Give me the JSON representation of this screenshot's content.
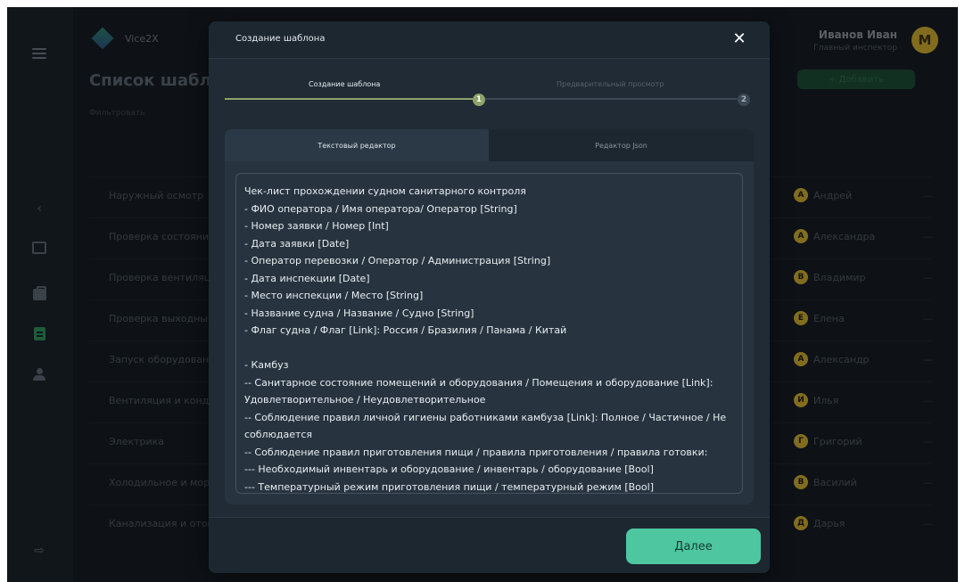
{
  "app": {
    "brand": "Vice2X"
  },
  "user": {
    "name": "Иванов Иван",
    "role": "Главный инспектор",
    "avatar_letter": "M"
  },
  "page": {
    "title": "Список шаблонов",
    "filter_label": "Фильтровать",
    "add_button": "+ Добавить",
    "rows": [
      {
        "name": "Наружный осмотр",
        "user": "Андрей",
        "av": "А",
        "color": "#c8a830"
      },
      {
        "name": "Проверка состояния",
        "user": "Александра",
        "av": "А",
        "color": "#c8a830"
      },
      {
        "name": "Проверка вентиляции",
        "user": "Владимир",
        "av": "В",
        "color": "#c8a830"
      },
      {
        "name": "Проверка выходных",
        "user": "Елена",
        "av": "Е",
        "color": "#c8a830"
      },
      {
        "name": "Запуск оборудования",
        "user": "Александр",
        "av": "А",
        "color": "#c8a830"
      },
      {
        "name": "Вентиляция и конд",
        "user": "Илья",
        "av": "И",
        "color": "#c8a830"
      },
      {
        "name": "Электрика",
        "user": "Григорий",
        "av": "Г",
        "color": "#c8a830"
      },
      {
        "name": "Холодильное и мор",
        "user": "Василий",
        "av": "В",
        "color": "#c8a830"
      },
      {
        "name": "Канализация и отопление",
        "user": "Дарья",
        "av": "Д",
        "color": "#c8a830"
      }
    ]
  },
  "modal": {
    "title": "Создание шаблона",
    "close_icon": "close-icon",
    "steps": [
      {
        "label": "Создание шаблона",
        "number": "1"
      },
      {
        "label": "Предварительный просмотр",
        "number": "2"
      }
    ],
    "tabs": [
      {
        "label": "Текстовый редактор"
      },
      {
        "label": "Редактор Json"
      }
    ],
    "editor_lines": [
      "Чек-лист прохождении судном санитарного контроля",
      "- ФИО оператора / Имя оператора/ Оператор [String]",
      "- Номер заявки / Номер [Int]",
      "- Дата заявки [Date]",
      "- Оператор перевозки / Оператор / Администрация [String]",
      "- Дата инспекции [Date]",
      "- Место инспекции / Место [String]",
      "- Название судна / Название / Судно [String]",
      "- Флаг судна / Флаг [Link]: Россия / Бразилия / Панама / Китай",
      "",
      "- Камбуз",
      "-- Санитарное состояние помещений и оборудования / Помещения и оборудование [Link]:",
      "Удовлетворительное / Неудовлетворительное",
      "-- Соблюдение правил личной гигиены работниками камбуза [Link]: Полное / Частичное / Не",
      "соблюдается",
      "-- Соблюдение правил приготовления пищи / правила приготовления / правила готовки:",
      "--- Необходимый инвентарь и оборудование / инвентарь / оборудование [Bool]",
      "--- Температурный режим приготовления пищи / температурный режим [Bool]"
    ],
    "next_button": "Далее"
  },
  "colors": {
    "accent": "#4ec7a0",
    "progress": "#8da36a",
    "modal_bg": "#202b35"
  }
}
